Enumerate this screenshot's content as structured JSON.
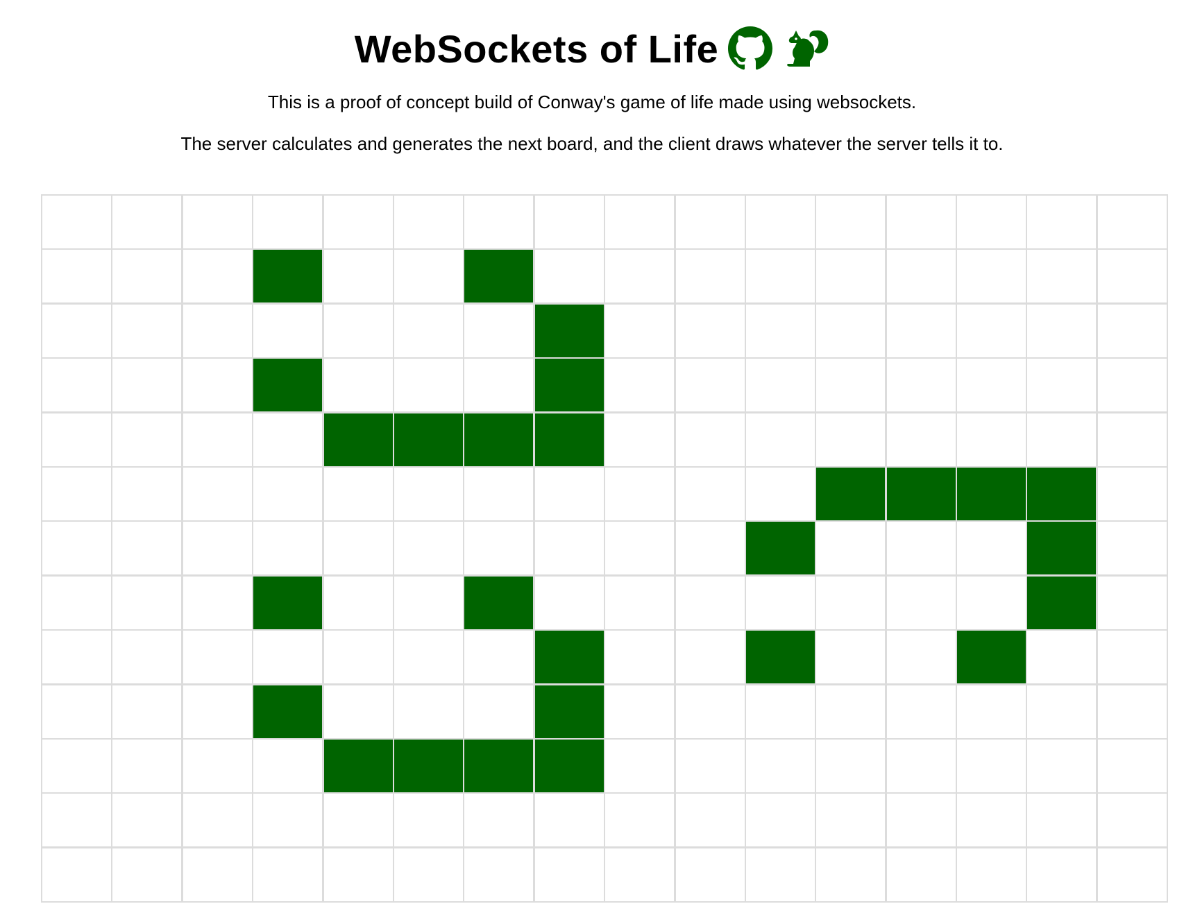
{
  "header": {
    "title": "WebSockets of Life",
    "github_icon": "github-icon",
    "squirrel_icon": "squirrel-icon",
    "description_1": "This is a proof of concept build of Conway's game of life made using websockets.",
    "description_2": "The server calculates and generates the next board, and the client draws whatever the server tells it to."
  },
  "colors": {
    "alive": "#006400",
    "dead": "#ffffff",
    "grid": "#dcdcdc",
    "icon": "#006400"
  },
  "board": {
    "rows": 13,
    "cols": 16,
    "alive_cells": [
      [
        1,
        3
      ],
      [
        1,
        6
      ],
      [
        2,
        7
      ],
      [
        3,
        3
      ],
      [
        3,
        7
      ],
      [
        4,
        4
      ],
      [
        4,
        5
      ],
      [
        4,
        6
      ],
      [
        4,
        7
      ],
      [
        5,
        11
      ],
      [
        5,
        12
      ],
      [
        5,
        13
      ],
      [
        5,
        14
      ],
      [
        6,
        10
      ],
      [
        6,
        14
      ],
      [
        7,
        3
      ],
      [
        7,
        6
      ],
      [
        7,
        14
      ],
      [
        8,
        7
      ],
      [
        8,
        10
      ],
      [
        8,
        13
      ],
      [
        9,
        3
      ],
      [
        9,
        7
      ],
      [
        10,
        4
      ],
      [
        10,
        5
      ],
      [
        10,
        6
      ],
      [
        10,
        7
      ]
    ]
  }
}
